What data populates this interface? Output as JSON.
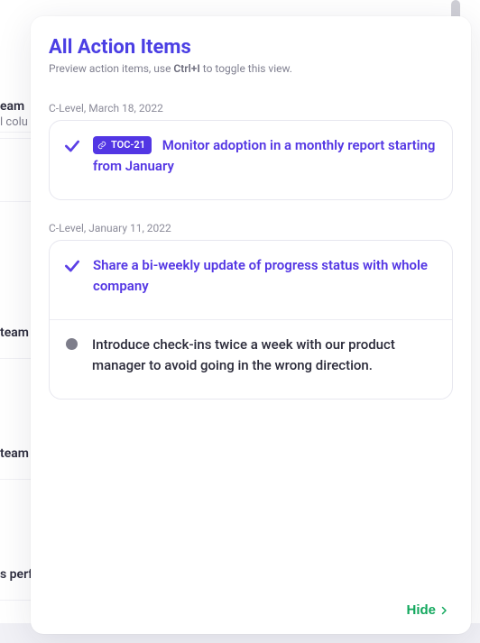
{
  "panel": {
    "title": "All Action Items",
    "subtitle_pre": "Preview action items, use ",
    "subtitle_kbd": "Ctrl+I",
    "subtitle_post": " to toggle this view."
  },
  "groups": [
    {
      "label": "C-Level, March 18, 2022",
      "items": [
        {
          "done": true,
          "tag": "TOC-21",
          "text": "Monitor adoption in a monthly report starting from January",
          "active": true
        }
      ]
    },
    {
      "label": "C-Level, January 11, 2022",
      "items": [
        {
          "done": true,
          "tag": null,
          "text": "Share a bi-weekly update of progress status with whole company",
          "active": true
        },
        {
          "done": false,
          "tag": null,
          "text": "Introduce check-ins twice a week with our product manager to avoid going in the wrong direction.",
          "active": false
        }
      ]
    }
  ],
  "footer": {
    "hide_label": "Hide"
  },
  "background_rows": [
    "eam",
    "l colu",
    "",
    "team",
    "",
    " team",
    "",
    "s perf"
  ]
}
